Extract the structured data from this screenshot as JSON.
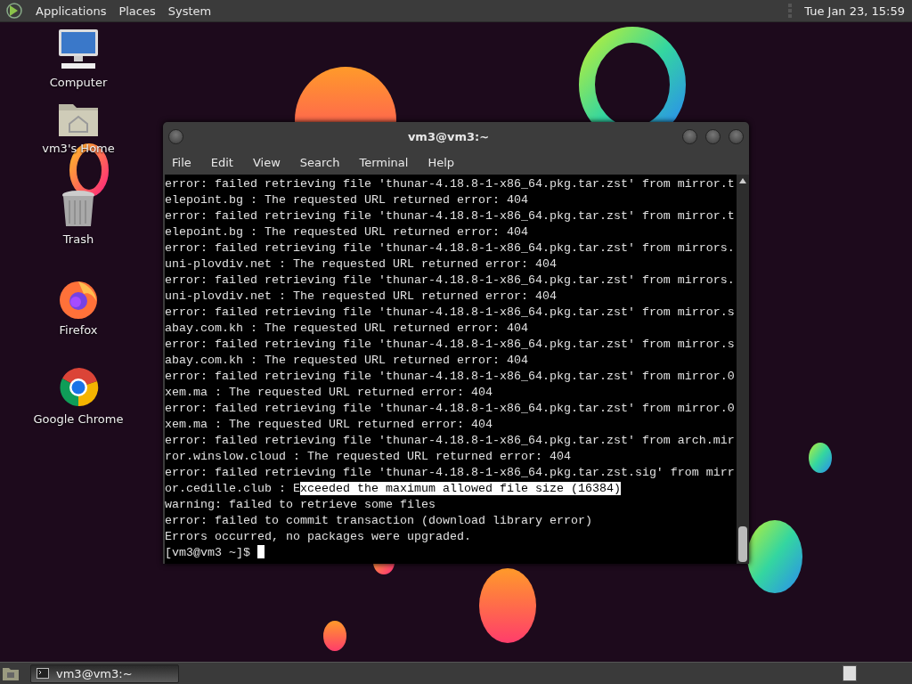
{
  "top_panel": {
    "menus": [
      "Applications",
      "Places",
      "System"
    ],
    "clock": "Tue Jan 23, 15:59"
  },
  "desktop_icons": [
    {
      "kind": "computer",
      "label": "Computer"
    },
    {
      "kind": "home",
      "label": "vm3's Home"
    },
    {
      "kind": "trash",
      "label": "Trash"
    },
    {
      "kind": "firefox",
      "label": "Firefox"
    },
    {
      "kind": "chrome",
      "label": "Google Chrome"
    }
  ],
  "terminal": {
    "title": "vm3@vm3:~",
    "menu": [
      "File",
      "Edit",
      "View",
      "Search",
      "Terminal",
      "Help"
    ],
    "lines": [
      {
        "text": "error: failed retrieving file 'thunar-4.18.8-1-x86_64.pkg.tar.zst' from mirror.t"
      },
      {
        "text": "elepoint.bg : The requested URL returned error: 404"
      },
      {
        "text": "error: failed retrieving file 'thunar-4.18.8-1-x86_64.pkg.tar.zst' from mirror.t"
      },
      {
        "text": "elepoint.bg : The requested URL returned error: 404"
      },
      {
        "text": "error: failed retrieving file 'thunar-4.18.8-1-x86_64.pkg.tar.zst' from mirrors."
      },
      {
        "text": "uni-plovdiv.net : The requested URL returned error: 404"
      },
      {
        "text": "error: failed retrieving file 'thunar-4.18.8-1-x86_64.pkg.tar.zst' from mirrors."
      },
      {
        "text": "uni-plovdiv.net : The requested URL returned error: 404"
      },
      {
        "text": "error: failed retrieving file 'thunar-4.18.8-1-x86_64.pkg.tar.zst' from mirror.s"
      },
      {
        "text": "abay.com.kh : The requested URL returned error: 404"
      },
      {
        "text": "error: failed retrieving file 'thunar-4.18.8-1-x86_64.pkg.tar.zst' from mirror.s"
      },
      {
        "text": "abay.com.kh : The requested URL returned error: 404"
      },
      {
        "text": "error: failed retrieving file 'thunar-4.18.8-1-x86_64.pkg.tar.zst' from mirror.0"
      },
      {
        "text": "xem.ma : The requested URL returned error: 404"
      },
      {
        "text": "error: failed retrieving file 'thunar-4.18.8-1-x86_64.pkg.tar.zst' from mirror.0"
      },
      {
        "text": "xem.ma : The requested URL returned error: 404"
      },
      {
        "text": "error: failed retrieving file 'thunar-4.18.8-1-x86_64.pkg.tar.zst' from arch.mir"
      },
      {
        "text": "ror.winslow.cloud : The requested URL returned error: 404"
      },
      {
        "text": "error: failed retrieving file 'thunar-4.18.8-1-x86_64.pkg.tar.zst.sig' from mirr"
      },
      {
        "text": "or.cedille.club : E",
        "highlight": "xceeded the maximum allowed file size (16384)"
      },
      {
        "text": "warning: failed to retrieve some files"
      },
      {
        "text": "error: failed to commit transaction (download library error)"
      },
      {
        "text": "Errors occurred, no packages were upgraded."
      }
    ],
    "prompt": "[vm3@vm3 ~]$"
  },
  "taskbar": {
    "tasks": [
      {
        "label": "vm3@vm3:~",
        "selected": true
      }
    ]
  }
}
